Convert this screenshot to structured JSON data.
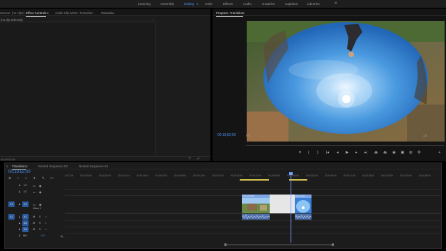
{
  "workspaces": {
    "items": [
      "Learning",
      "Assembly",
      "Editing",
      "Color",
      "Effects",
      "Audio",
      "Graphics",
      "Captions",
      "Libraries"
    ],
    "active": "Editing",
    "menu_icon": "hamburger-icon",
    "more_icon": "chevron-double-right-icon"
  },
  "source_panel": {
    "tabs": [
      "Source: (no clips)",
      "Effect Controls",
      "Audio Clip Mixer: Transition",
      "Metadata"
    ],
    "active_tab": "Effect Controls",
    "tab_menu": "≡",
    "subhead": "(no clip selected)",
    "timecode": "00;00;00;00"
  },
  "program_panel": {
    "title": "Program: Transition",
    "tab_menu": "≡",
    "timecode": "00;19;52;00",
    "fit": "Fit",
    "resolution": "1/4"
  },
  "timeline": {
    "tabs": [
      "Transition",
      "Nested Sequence 03",
      "Nested Sequence 04"
    ],
    "active_tab": "Transition",
    "timecode": "00;19;52;00",
    "ruler_ticks": [
      "00;17;04",
      "00;18;25;04",
      "00;18;33;04",
      "00;18;41;04",
      "00;18;49;04",
      "00;18;57;04",
      "00;19;05;04",
      "00;19;13;06",
      "00;19;21;06",
      "00;19;29;06",
      "00;19;37;06",
      "00;19;45;06",
      "00;19;53;06",
      "00;20;01;06",
      "00;20;09;06",
      "00;20;17;06",
      "00;20;25;06",
      "00;20;33;06",
      "00;20;42;06",
      "00;20;50;06"
    ],
    "tracks": {
      "video": [
        {
          "id": "V3",
          "label": "V3"
        },
        {
          "id": "V2",
          "label": "V2"
        },
        {
          "id": "V1",
          "label": "V1",
          "name": "Video 1"
        }
      ],
      "audio": [
        {
          "id": "A1",
          "label": "A1"
        },
        {
          "id": "A2",
          "label": "A2"
        },
        {
          "id": "A3",
          "label": "A3"
        }
      ],
      "mix": {
        "label": "Mix",
        "value": "0.0"
      }
    },
    "clips": [
      {
        "label": "VID_202208..."
      },
      {
        "label": "VID_2022..."
      }
    ]
  },
  "colors": {
    "accent": "#4a8ff0",
    "clip_blue": "#7ea6e6",
    "yellow": "#d8c650"
  }
}
